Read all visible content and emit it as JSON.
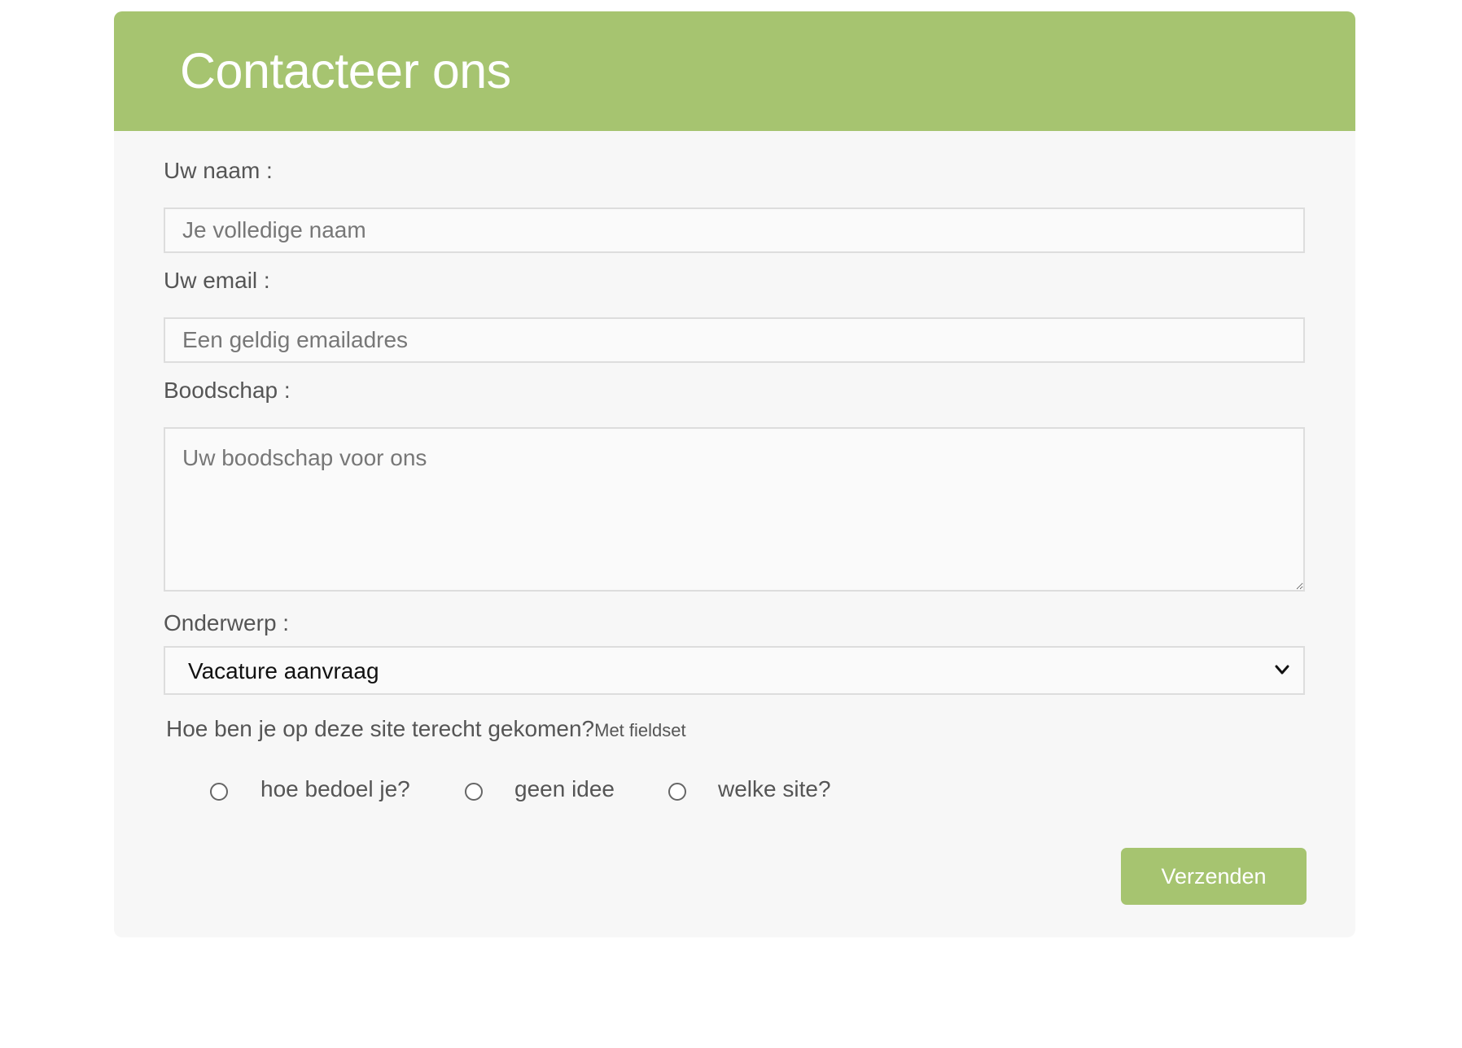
{
  "header": {
    "title": "Contacteer ons"
  },
  "form": {
    "name": {
      "label": "Uw naam :",
      "placeholder": "Je volledige naam",
      "value": ""
    },
    "email": {
      "label": "Uw email :",
      "placeholder": "Een geldig emailadres",
      "value": ""
    },
    "message": {
      "label": "Boodschap :",
      "placeholder": "Uw boodschap voor ons",
      "value": ""
    },
    "subject": {
      "label": "Onderwerp :",
      "selected": "Vacature aanvraag"
    },
    "source": {
      "legend": "Hoe ben je op deze site terecht gekomen?",
      "legend_note": "Met fieldset",
      "options": [
        {
          "label": "hoe bedoel je?",
          "checked": false
        },
        {
          "label": "geen idee",
          "checked": false
        },
        {
          "label": "welke site?",
          "checked": false
        }
      ]
    },
    "submit_label": "Verzenden"
  },
  "colors": {
    "accent": "#a6c470",
    "card_background": "#f7f7f7",
    "input_border": "#dddddd",
    "label_text": "#555555"
  }
}
